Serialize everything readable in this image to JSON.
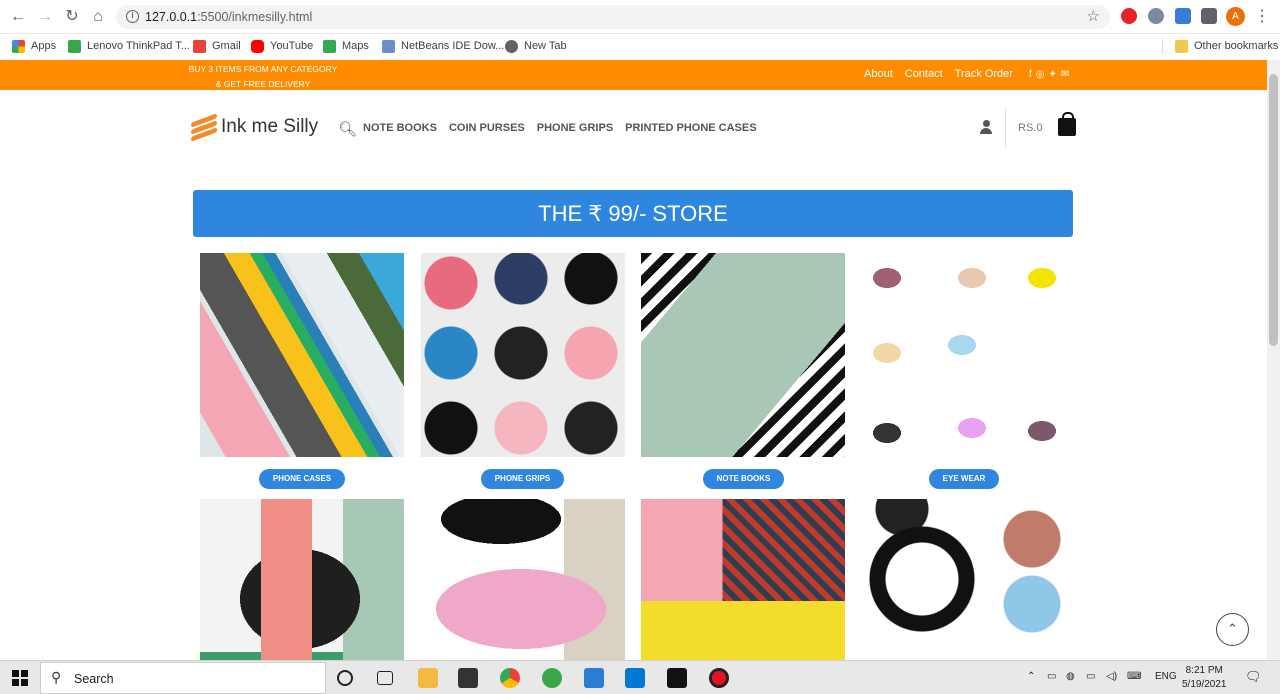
{
  "browser": {
    "url_host": "127.0.0.1",
    "url_rest": ":5500/inkmesilly.html",
    "profile_initial": "A",
    "bookmarks": [
      {
        "label": "Apps",
        "icon": "apps-grid-icon"
      },
      {
        "label": "Lenovo ThinkPad T...",
        "icon": "lenovo-icon"
      },
      {
        "label": "Gmail",
        "icon": "gmail-icon"
      },
      {
        "label": "YouTube",
        "icon": "youtube-icon"
      },
      {
        "label": "Maps",
        "icon": "maps-icon"
      },
      {
        "label": "NetBeans IDE Dow...",
        "icon": "netbeans-icon"
      },
      {
        "label": "New Tab",
        "icon": "globe-icon"
      }
    ],
    "other_bookmarks": "Other bookmarks"
  },
  "topbar": {
    "promo_line1": "BUY 3 ITEMS FROM ANY CATEGORY",
    "promo_line2": "& GET FREE DELIVERY",
    "links": [
      "About",
      "Contact",
      "Track Order"
    ]
  },
  "header": {
    "logo": "Ink me Silly",
    "menu": [
      "NOTE BOOKS",
      "COIN PURSES",
      "PHONE GRIPS",
      "PRINTED PHONE CASES"
    ],
    "cart_total": "RS.0"
  },
  "banner": {
    "title": "THE ₹ 99/- STORE"
  },
  "categories": [
    {
      "label": "PHONE CASES"
    },
    {
      "label": "PHONE GRIPS"
    },
    {
      "label": "NOTE BOOKS"
    },
    {
      "label": "EYE WEAR"
    }
  ],
  "taskbar": {
    "search_placeholder": "Search",
    "lang": "ENG",
    "time": "8:21 PM",
    "date": "5/19/2021"
  },
  "colors": {
    "accent_orange": "#ff8c00",
    "accent_blue": "#2e86de"
  }
}
